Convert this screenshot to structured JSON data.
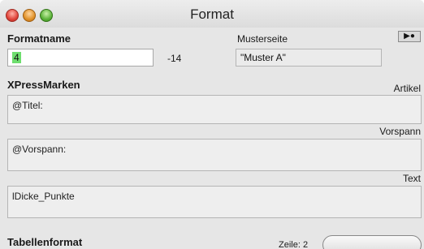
{
  "window": {
    "title": "Format"
  },
  "formatname": {
    "label": "Formatname",
    "value": "4",
    "suffix": "-14"
  },
  "musterseite": {
    "label": "Musterseite",
    "value": "\"Muster A\"",
    "menu_glyph": "▶●"
  },
  "xpressmarken": {
    "label": "XPressMarken"
  },
  "sections": [
    {
      "label": "Artikel",
      "value": "@Titel:"
    },
    {
      "label": "Vorspann",
      "value": "@Vorspann:"
    },
    {
      "label": "Text",
      "value": "lDicke_Punkte"
    }
  ],
  "tabellenformat": {
    "label": "Tabellenformat"
  },
  "status": {
    "zeile": "Zeile: 2"
  },
  "icons": [
    "close-icon",
    "minimize-icon",
    "zoom-icon",
    "popup-menu-icon"
  ]
}
